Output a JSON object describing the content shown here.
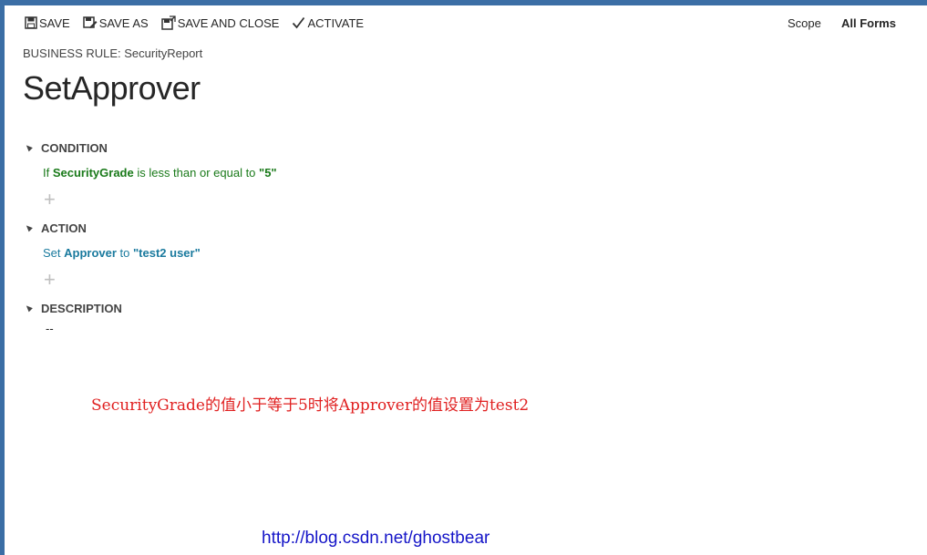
{
  "toolbar": {
    "save": "SAVE",
    "save_as": "SAVE AS",
    "save_and_close": "SAVE AND CLOSE",
    "activate": "ACTIVATE"
  },
  "scope": {
    "label": "Scope",
    "value": "All Forms"
  },
  "breadcrumb": "BUSINESS RULE: SecurityReport",
  "title": "SetApprover",
  "condition": {
    "header": "CONDITION",
    "prefix": "If ",
    "field": "SecurityGrade",
    "operator": " is less than or equal to ",
    "value": "\"5\""
  },
  "action": {
    "header": "ACTION",
    "prefix": "Set ",
    "field": "Approver",
    "operator": " to ",
    "value": "\"test2 user\""
  },
  "description": {
    "header": "DESCRIPTION",
    "value": "--"
  },
  "plus_glyph": "+",
  "annotation": "SecurityGrade的值小于等于5时将Approver的值设置为test2",
  "watermark": "http://blog.csdn.net/ghostbear",
  "colors": {
    "frame": "#3b6ea5",
    "condition_text": "#1a7a1a",
    "action_text": "#1a7a9e",
    "annotation": "#e02020",
    "watermark": "#1515c8"
  }
}
